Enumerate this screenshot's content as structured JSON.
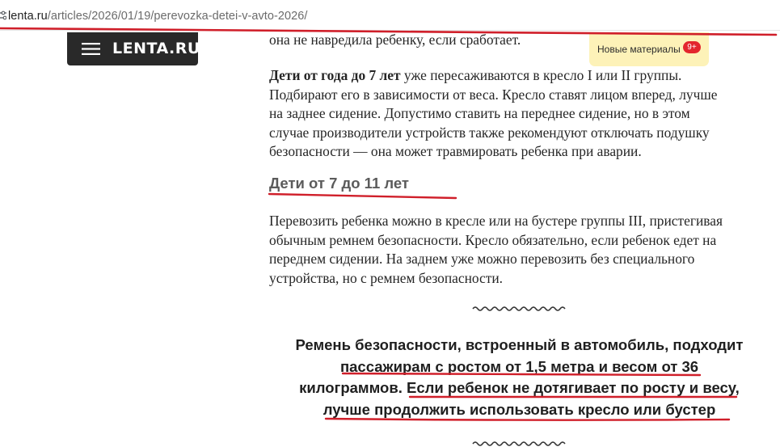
{
  "browser": {
    "url_host": "lenta.ru",
    "url_path": "/articles/2026/01/19/perevozka-detei-v-avto-2026/"
  },
  "header": {
    "logo_text": "LENTA.RU",
    "new_materials_label": "Новые материалы",
    "new_materials_count": "9+"
  },
  "article": {
    "top_line": "она не навредила ребенку, если сработает.",
    "para1": {
      "lead_bold": "Дети от года до 7 лет",
      "line1_rest": " уже пересаживаются в кресло I или II группы.",
      "line2": "Подбирают его в зависимости от веса. Кресло ставят лицом вперед, лучше",
      "line3": "на заднее сидение. Допустимо ставить на переднее сидение, но в этом",
      "line4": "случае производители устройств также рекомендуют отключать подушку",
      "line5": "безопасности — она может травмировать ребенка при аварии."
    },
    "heading": "Дети от 7 до 11 лет",
    "para2": {
      "line1": "Перевозить ребенка можно в кресле или на бустере группы III, пристегивая",
      "line2": "обычным ремнем безопасности. Кресло обязательно, если ребенок едет на",
      "line3": "переднем сидении. На заднем уже можно перевозить без специального",
      "line4": "устройства, но с ремнем безопасности."
    },
    "quote": {
      "line1": "Ремень безопасности, встроенный в автомобиль, подходит",
      "line2": "пассажирам с ростом от 1,5 метра и весом от 36",
      "line3": "килограммов. Если ребенок не дотягивает по росту и весу,",
      "line4": "лучше продолжить использовать кресло или бустер"
    }
  },
  "colors": {
    "annotation_red": "#d01f2a",
    "logo_background": "#292929",
    "new_materials_background": "#fdf2b8",
    "badge_red": "#e3262d"
  },
  "icons": {
    "url_bar": "site-settings-icon",
    "logo_menu": "hamburger-menu-icon",
    "divider": "wavy-divider-icon"
  }
}
